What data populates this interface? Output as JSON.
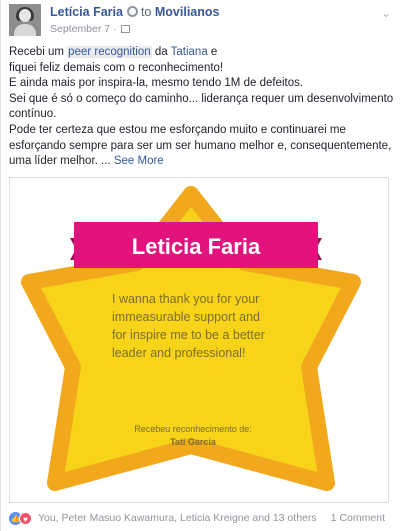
{
  "post": {
    "author": "Letícia Faria",
    "to_text": "to",
    "group": "Movilianos",
    "date": "September 7",
    "date_sep": "·",
    "text": {
      "l1_a": "Recebi um ",
      "l1_link": "peer recognition",
      "l1_b": " da ",
      "l1_tag": "Tatiana",
      "l1_c": " e",
      "l2": "fiquei feliz demais com o reconhecimento!",
      "l3": "E ainda mais por inspira-la, mesmo tendo 1M de defeitos.",
      "l4": "Sei que é só o começo do caminho... liderança requer um desenvolvimento",
      "l5": "contínuo.",
      "l6": "Pode ter certeza que estou me esforçando muito e continuarei me",
      "l7": "esforçando sempre para ser um ser humano melhor e, consequentemente,",
      "l8_a": "uma líder melhor. ... ",
      "see_more": "See More"
    }
  },
  "card_image": {
    "banner_name": "Leticia Faria",
    "message_lines": [
      "I wanna thank you for your",
      "immeasurable support and",
      "for inspire me to be a better",
      "leader and professional!"
    ],
    "received_label": "Recebeu reconhecimento de:",
    "received_from": "Tati Garcia",
    "colors": {
      "star_fill": "#f7d31a",
      "star_stroke": "#f2a81d",
      "banner": "#e3137d",
      "banner_dark": "#9e1057",
      "message_text": "#7d6f2a"
    }
  },
  "footer": {
    "reactors": "You, Peter Masuo Kawamura, Leticia Kreigne and 13 others",
    "comments": "1 Comment"
  },
  "icons": {
    "verified": "verified-icon",
    "calendar": "calendar-icon",
    "chevron": "chevron-down-icon",
    "like": "like-icon",
    "love": "love-icon"
  }
}
